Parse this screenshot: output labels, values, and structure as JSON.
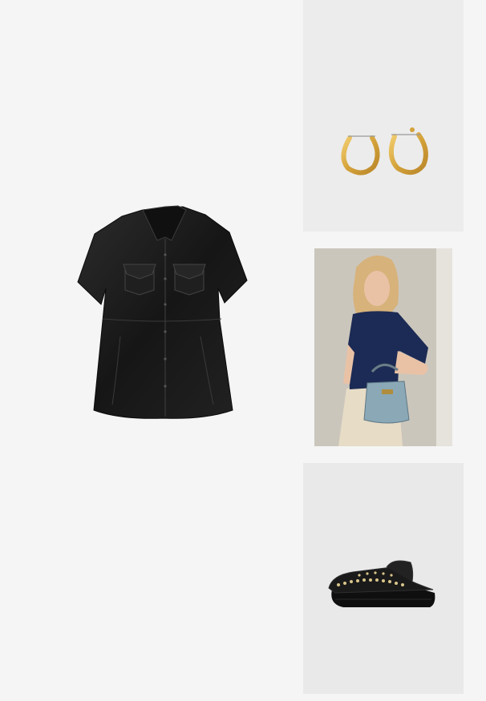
{
  "collage": {
    "products": [
      {
        "kind": "leather shirt dress",
        "color": "#1b1b1b"
      },
      {
        "kind": "gold hoop earrings",
        "color": "#d6a640"
      },
      {
        "kind": "model with denim handbag",
        "color": "#7f9fae"
      },
      {
        "kind": "studded leather mule",
        "color": "#141414"
      }
    ]
  }
}
